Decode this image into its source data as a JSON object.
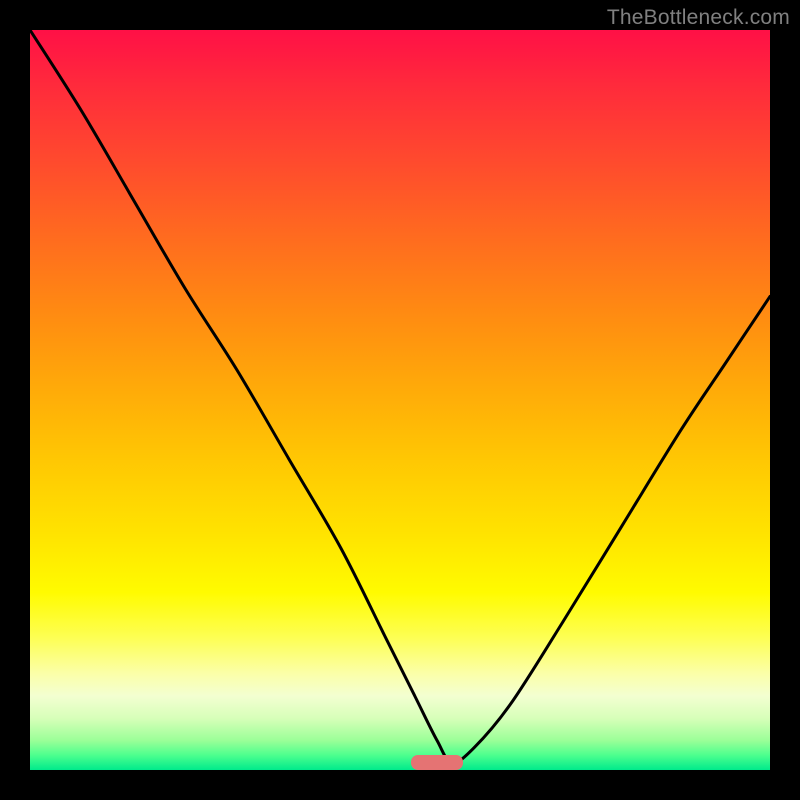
{
  "watermark": "TheBottleneck.com",
  "chart_data": {
    "type": "line",
    "title": "",
    "xlabel": "",
    "ylabel": "",
    "xlim": [
      0,
      100
    ],
    "ylim": [
      0,
      100
    ],
    "series": [
      {
        "name": "bottleneck-curve",
        "x": [
          0,
          7,
          14,
          21,
          28,
          35,
          42,
          48,
          52,
          55,
          57,
          60,
          65,
          72,
          80,
          88,
          94,
          100
        ],
        "y": [
          100,
          89,
          77,
          65,
          54,
          42,
          30,
          18,
          10,
          4,
          1,
          3,
          9,
          20,
          33,
          46,
          55,
          64
        ]
      }
    ],
    "marker": {
      "x": 55,
      "width": 7,
      "height": 2
    },
    "gradient_stops": [
      {
        "pos": 0,
        "color": "#ff1046"
      },
      {
        "pos": 50,
        "color": "#ffc703"
      },
      {
        "pos": 80,
        "color": "#fffb00"
      },
      {
        "pos": 100,
        "color": "#00ea8c"
      }
    ]
  }
}
